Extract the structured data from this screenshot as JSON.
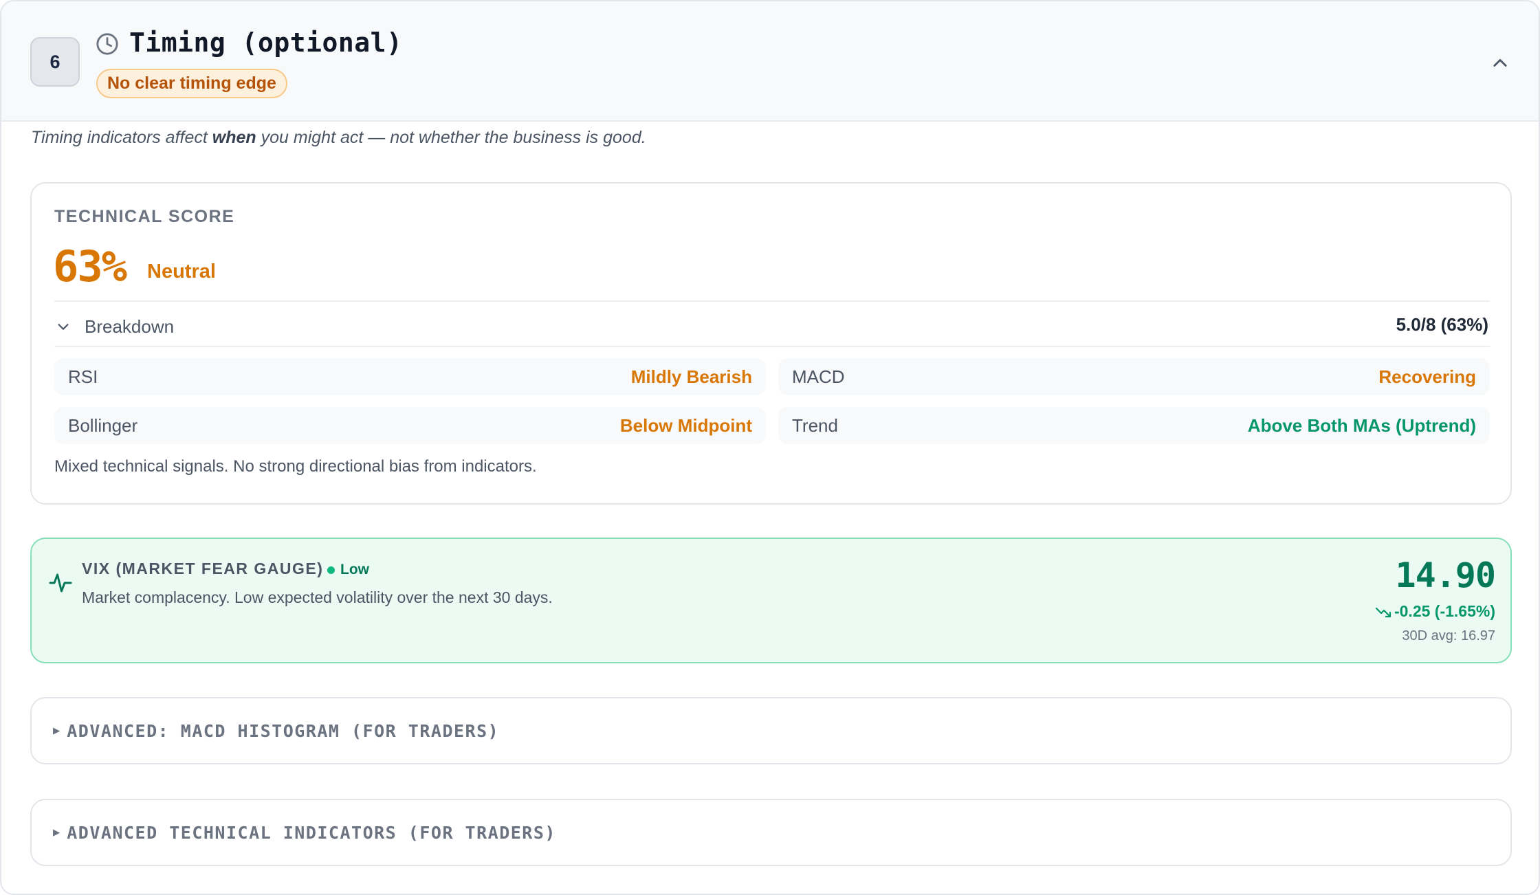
{
  "section": {
    "step": "6",
    "title": "Timing (optional)",
    "badge": "No clear timing edge"
  },
  "intro": {
    "before": "Timing indicators affect ",
    "emphasis": "when",
    "after": " you might act — not whether the business is good."
  },
  "technical": {
    "label": "TECHNICAL SCORE",
    "score": "63%",
    "verdict": "Neutral",
    "breakdown_label": "Breakdown",
    "breakdown_total": "5.0/8 (63%)",
    "indicators": [
      {
        "name": "RSI",
        "value": "Mildly Bearish",
        "color": "#d97706"
      },
      {
        "name": "MACD",
        "value": "Recovering",
        "color": "#d97706"
      },
      {
        "name": "Bollinger",
        "value": "Below Midpoint",
        "color": "#d97706"
      },
      {
        "name": "Trend",
        "value": "Above Both MAs (Uptrend)",
        "color": "#059669"
      }
    ],
    "note": "Mixed technical signals. No strong directional bias from indicators."
  },
  "vix": {
    "title": "VIX (MARKET FEAR GAUGE)",
    "level": "Low",
    "description": "Market complacency. Low expected volatility over the next 30 days.",
    "value": "14.90",
    "change": "-0.25 (-1.65%)",
    "avg": "30D avg: 16.97"
  },
  "advanced": {
    "macd_label": "ADVANCED: MACD HISTOGRAM (FOR TRADERS)",
    "indicators_label": "ADVANCED TECHNICAL INDICATORS (FOR TRADERS)"
  },
  "colors": {
    "accent_amber": "#d97706",
    "accent_green": "#059669",
    "vix_bg": "#ebfbf3"
  },
  "icons": {
    "header": "clock-icon",
    "collapse": "chevron-up-icon",
    "breakdown": "chevron-down-icon",
    "vix": "pulse-icon",
    "change": "trend-down-icon",
    "advanced": "caret-right-icon"
  }
}
